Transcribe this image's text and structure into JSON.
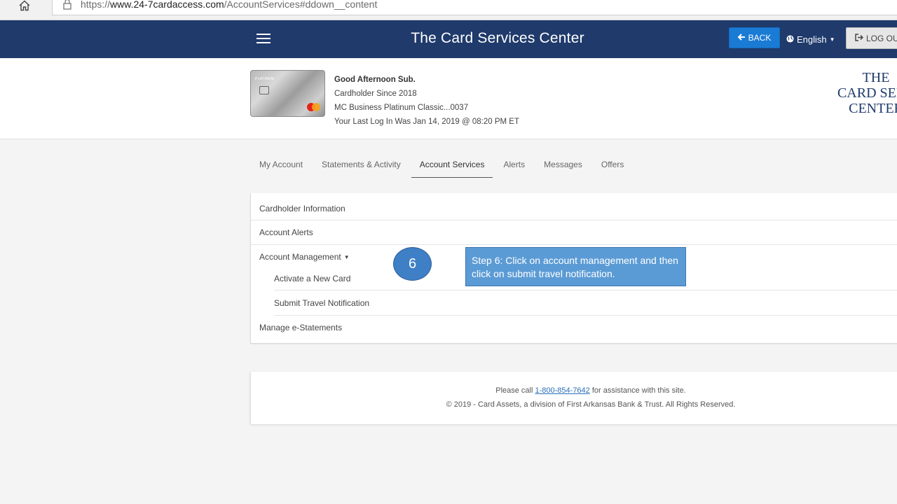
{
  "browser": {
    "url_scheme": "https://",
    "url_domain": "www.24-7cardaccess.com",
    "url_path": "/AccountServices#ddown__content"
  },
  "header": {
    "title": "The Card Services Center",
    "back_label": "BACK",
    "language_label": "English",
    "logout_label": "LOG OU",
    "bar_color": "#1f3a6b",
    "back_color": "#1a7bd5"
  },
  "account": {
    "greeting": "Good Afternoon Sub.",
    "since": "Cardholder Since 2018",
    "card": "MC Business Platinum Classic...0037",
    "last_login": "Your Last Log In Was Jan 14, 2019 @ 08:20 PM ET",
    "card_label": "PLATINUM"
  },
  "brand": {
    "line1": "THE",
    "line2": "CARD SERV",
    "line3": "CENTER"
  },
  "tabs": [
    {
      "label": "My Account"
    },
    {
      "label": "Statements & Activity"
    },
    {
      "label": "Account Services"
    },
    {
      "label": "Alerts"
    },
    {
      "label": "Messages"
    },
    {
      "label": "Offers"
    }
  ],
  "menu": {
    "cardholder_info": "Cardholder Information",
    "account_alerts": "Account Alerts",
    "account_management": "Account Management",
    "activate_card": "Activate a New Card",
    "travel_notification": "Submit Travel Notification",
    "estatements": "Manage e-Statements"
  },
  "annotation": {
    "step_number": "6",
    "step_text": "Step 6: Click on account management and then click on submit travel notification."
  },
  "footer": {
    "call_prefix": "Please call ",
    "phone": "1-800-854-7642",
    "call_suffix": " for assistance with this site.",
    "copyright": "© 2019 - Card Assets, a division of First Arkansas Bank & Trust. All Rights Reserved."
  }
}
